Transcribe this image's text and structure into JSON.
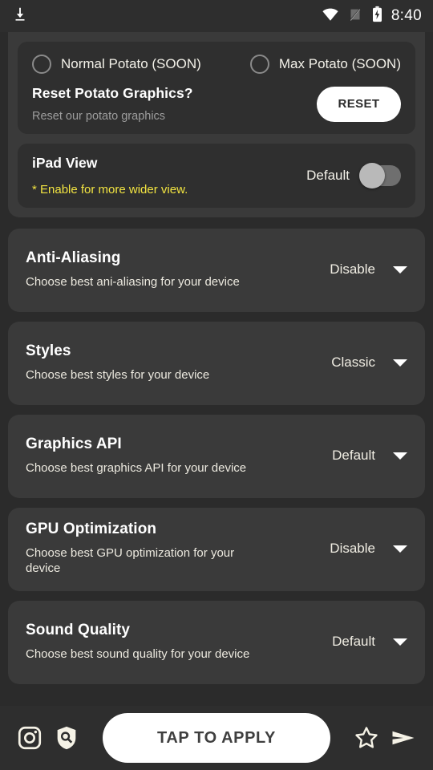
{
  "statusbar": {
    "time": "8:40",
    "icons": [
      "download-icon",
      "wifi-icon",
      "signal-off-icon",
      "battery-charging-icon"
    ]
  },
  "potato_group": {
    "radios": [
      {
        "label": "Normal Potato (SOON)",
        "selected": false
      },
      {
        "label": "Max Potato (SOON)",
        "selected": false
      }
    ],
    "reset": {
      "title": "Reset Potato  Graphics?",
      "subtitle": "Reset our potato graphics",
      "button": "RESET"
    },
    "ipad": {
      "title": "iPad View",
      "note": "* Enable for more wider view.",
      "note_color": "#f2e441",
      "toggle_label": "Default",
      "toggle_on": false
    }
  },
  "settings": [
    {
      "title": "Anti-Aliasing",
      "subtitle": "Choose best ani-aliasing for your device",
      "value": "Disable"
    },
    {
      "title": "Styles",
      "subtitle": "Choose best styles for your device",
      "value": "Classic"
    },
    {
      "title": "Graphics API",
      "subtitle": "Choose best graphics API for your device",
      "value": "Default"
    },
    {
      "title": "GPU Optimization",
      "subtitle": "Choose best GPU optimization for your device",
      "value": "Disable"
    },
    {
      "title": "Sound Quality",
      "subtitle": "Choose best sound quality for your device",
      "value": "Default"
    }
  ],
  "bottombar": {
    "apply_label": "TAP TO APPLY",
    "left_icons": [
      "instagram-icon",
      "shield-search-icon"
    ],
    "right_icons": [
      "star-icon",
      "send-icon"
    ]
  },
  "theme": {
    "page_bg": "#2b2b2b",
    "card_bg": "#3a3a3a",
    "inner_card_bg": "#2f2f2f",
    "accent_white": "#ffffff",
    "text_cream": "#f0ede3",
    "warning_yellow": "#f2e441",
    "icon_cream": "#f5f2e6"
  }
}
